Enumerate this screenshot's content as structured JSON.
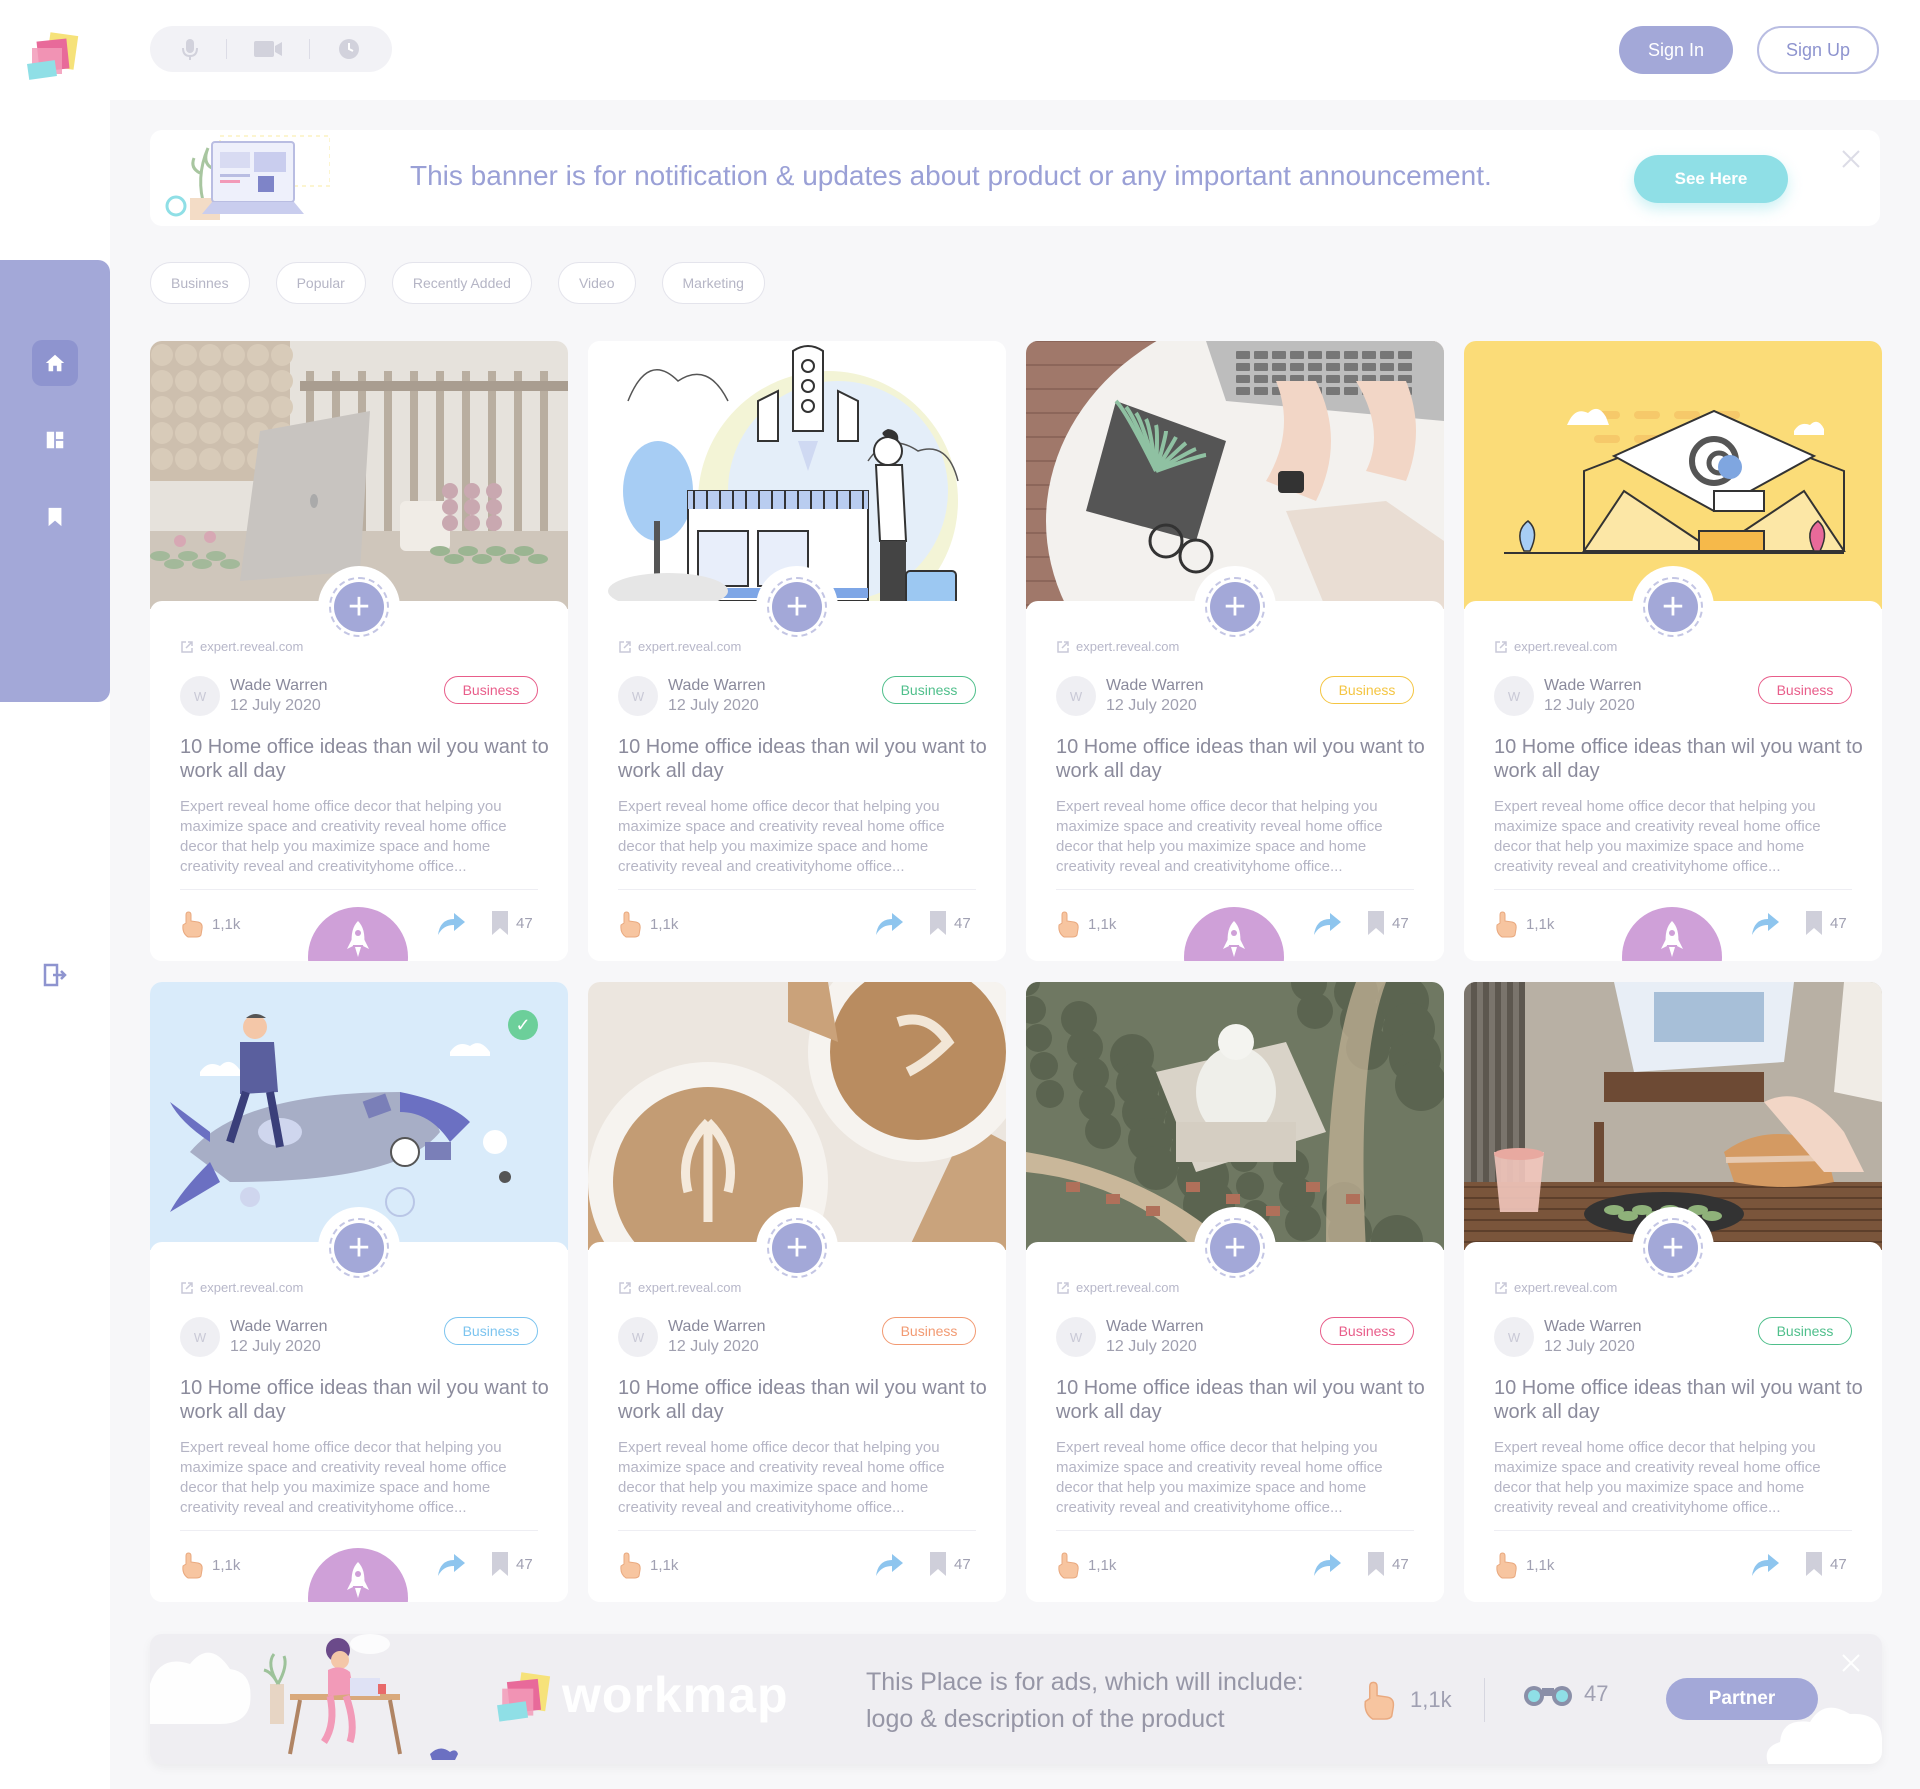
{
  "sidebar": {
    "nav": [
      {
        "icon": "home-icon",
        "active": true
      },
      {
        "icon": "dashboard-icon",
        "active": false
      },
      {
        "icon": "bookmark-icon",
        "active": false
      }
    ],
    "logout_icon": "logout-icon"
  },
  "header": {
    "media_icons": [
      "microphone-icon",
      "video-camera-icon",
      "clock-icon"
    ],
    "sign_in_label": "Sign In",
    "sign_up_label": "Sign Up"
  },
  "banner": {
    "text": "This banner is for notification & updates about product or any important announcement.",
    "button_label": "See Here"
  },
  "filters": [
    "Businnes",
    "Popular",
    "Recently Added",
    "Video",
    "Marketing"
  ],
  "cards": [
    {
      "image": "photo-laptop-garden",
      "source": "expert.reveal.com",
      "avatar_initial": "W",
      "author": "Wade Warren",
      "date": "12 July 2020",
      "tag": "Business",
      "tag_color": "#e85d8a",
      "title": "10 Home office ideas than wil  you want to work all day",
      "description": "Expert reveal home office decor that helping you maximize space and creativity reveal home office decor that help you maximize space and home creativity reveal  and creativityhome office...",
      "likes": "1,1k",
      "saves": "47",
      "rocket": true,
      "checked": false
    },
    {
      "image": "illustration-rocket-launch",
      "source": "expert.reveal.com",
      "avatar_initial": "W",
      "author": "Wade Warren",
      "date": "12 July 2020",
      "tag": "Business",
      "tag_color": "#4fbf8b",
      "title": "10 Home office ideas than wil  you want to work all day",
      "description": "Expert reveal home office decor that helping you maximize space and creativity reveal home office decor that help you maximize space and home creativity reveal  and creativityhome office...",
      "likes": "1,1k",
      "saves": "47",
      "rocket": false,
      "checked": false
    },
    {
      "image": "photo-laptop-typing",
      "source": "expert.reveal.com",
      "avatar_initial": "W",
      "author": "Wade Warren",
      "date": "12 July 2020",
      "tag": "Business",
      "tag_color": "#f4c542",
      "title": "10 Home office ideas than wil  you want to work all day",
      "description": "Expert reveal home office decor that helping you maximize space and creativity reveal home office decor that help you maximize space and home creativity reveal  and creativityhome office...",
      "likes": "1,1k",
      "saves": "47",
      "rocket": true,
      "checked": false
    },
    {
      "image": "illustration-envelope-yellow",
      "source": "expert.reveal.com",
      "avatar_initial": "W",
      "author": "Wade Warren",
      "date": "12 July 2020",
      "tag": "Business",
      "tag_color": "#e85d8a",
      "title": "10 Home office ideas than wil  you want to work all day",
      "description": "Expert reveal home office decor that helping you maximize space and creativity reveal home office decor that help you maximize space and home creativity reveal  and creativityhome office...",
      "likes": "1,1k",
      "saves": "47",
      "rocket": true,
      "checked": false
    },
    {
      "image": "illustration-man-on-rocket",
      "source": "expert.reveal.com",
      "avatar_initial": "W",
      "author": "Wade Warren",
      "date": "12 July 2020",
      "tag": "Business",
      "tag_color": "#7cc4ef",
      "title": "10 Home office ideas than wil  you want to work all day",
      "description": "Expert reveal home office decor that helping you maximize space and creativity reveal home office decor that help you maximize space and home creativity reveal  and creativityhome office...",
      "likes": "1,1k",
      "saves": "47",
      "rocket": true,
      "checked": true
    },
    {
      "image": "photo-latte-coffee",
      "source": "expert.reveal.com",
      "avatar_initial": "W",
      "author": "Wade Warren",
      "date": "12 July 2020",
      "tag": "Business",
      "tag_color": "#f29a72",
      "title": "10 Home office ideas than wil  you want to work all day",
      "description": "Expert reveal home office decor that helping you maximize space and creativity reveal home office decor that help you maximize space and home creativity reveal  and creativityhome office...",
      "likes": "1,1k",
      "saves": "47",
      "rocket": false,
      "checked": false
    },
    {
      "image": "photo-aerial-buddha",
      "source": "expert.reveal.com",
      "avatar_initial": "W",
      "author": "Wade Warren",
      "date": "12 July 2020",
      "tag": "Business",
      "tag_color": "#e85d8a",
      "title": "10 Home office ideas than wil  you want to work all day",
      "description": "Expert reveal home office decor that helping you maximize space and creativity reveal home office decor that help you maximize space and home creativity reveal  and creativityhome office...",
      "likes": "1,1k",
      "saves": "47",
      "rocket": false,
      "checked": false
    },
    {
      "image": "photo-food-table",
      "source": "expert.reveal.com",
      "avatar_initial": "W",
      "author": "Wade Warren",
      "date": "12 July 2020",
      "tag": "Business",
      "tag_color": "#4fbf8b",
      "title": "10 Home office ideas than wil  you want to work all day",
      "description": "Expert reveal home office decor that helping you maximize space and creativity reveal home office decor that help you maximize space and home creativity reveal  and creativityhome office...",
      "likes": "1,1k",
      "saves": "47",
      "rocket": false,
      "checked": false
    }
  ],
  "ad": {
    "brand": "workmap",
    "text_line1": "This Place is for ads, which will include:",
    "text_line2": "logo & description of the product",
    "likes": "1,1k",
    "views": "47",
    "button_label": "Partner"
  },
  "colors": {
    "accent": "#a3a8d8",
    "teal": "#8fdfe6",
    "rocket": "#cfa0d8"
  }
}
